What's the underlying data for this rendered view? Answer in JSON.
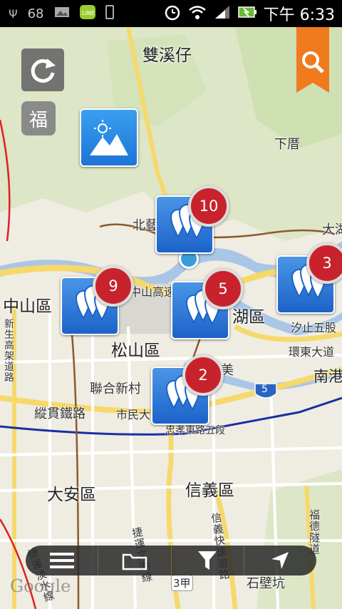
{
  "status_bar": {
    "battery_level": "68",
    "time": "下午 6:33"
  },
  "map": {
    "districts": {
      "zhongshan": "中山區",
      "songshan": "松山區",
      "neihu": "湖區",
      "daan": "大安區",
      "xinyi": "信義區"
    },
    "places": {
      "shuangxizai": "雙溪仔",
      "xiaping": "下厝",
      "beian": "北藝",
      "dahu": "大湖",
      "nangang": "南港",
      "lianhexincun": "聯合新村",
      "shibikeng": "石壁坑",
      "mei": "美"
    },
    "roads": {
      "zhongshan_hwy": "中山高速",
      "xizhi_wugu": "汐止五股",
      "huandong": "環東大道",
      "zongguan_rail": "縱貫鐵路",
      "shimin": "市民大",
      "zhongxiao_e5": "忠孝東路五段",
      "xinsheng": "新生高架道路",
      "hwy5": "5",
      "hwy3a": "3甲",
      "xinyi_express": "信義快速道路",
      "fude_tunnel": "福德隧道",
      "jiebao": "捷運文湖線",
      "danshui": "捷運淡水線"
    },
    "markers": [
      {
        "count": "10"
      },
      {
        "count": "9"
      },
      {
        "count": "5"
      },
      {
        "count": "3"
      },
      {
        "count": "2"
      }
    ],
    "google_logo": "Google",
    "fu_label": "福"
  },
  "colors": {
    "marker_blue": "#2b7ad8",
    "badge_red": "#c8232c",
    "search_orange": "#f07a1e"
  },
  "toolbar": {
    "icons": [
      "menu-icon",
      "folder-icon",
      "filter-icon",
      "navigate-icon"
    ]
  }
}
